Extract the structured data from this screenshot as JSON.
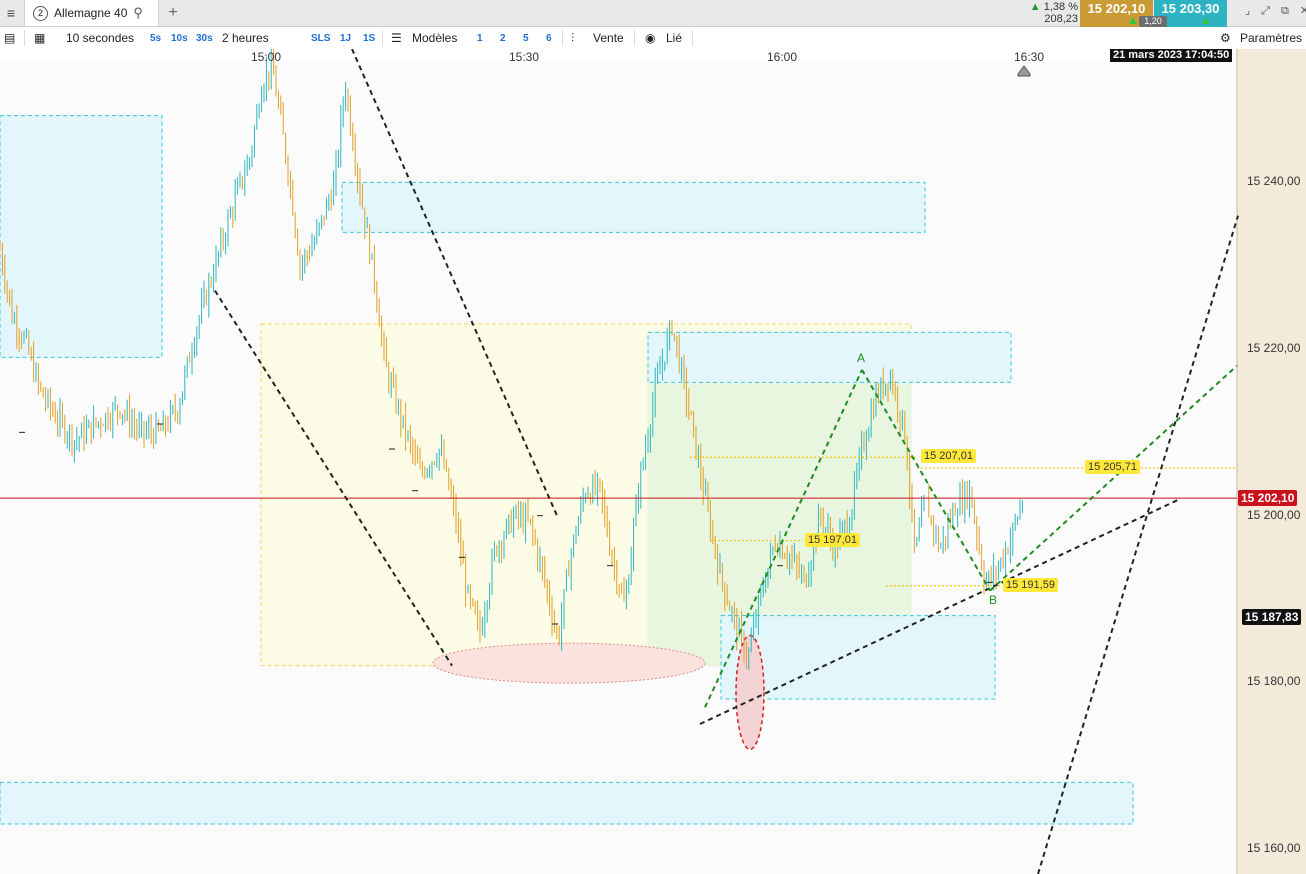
{
  "tabbar": {
    "tab_number": "2",
    "tab_label": "Allemagne 40",
    "change_pct": "1,38 %",
    "change_pts": "208,23",
    "bid": "15 202,10",
    "ask": "15 203,30",
    "spread": "1,20"
  },
  "toolbar": {
    "interval": "10 secondes",
    "quick_intervals": [
      "5s",
      "10s",
      "30s"
    ],
    "period": "2 heures",
    "quick_periods": [
      "SLS",
      "1J",
      "1S"
    ],
    "models_label": "Modèles",
    "model_slots": [
      "1",
      "2",
      "5",
      "6"
    ],
    "price_type": "Vente",
    "link_label": "Lié",
    "settings_label": "Paramètres"
  },
  "colors": {
    "bid_bg": "#c99a36",
    "ask_bg": "#2eb3c3",
    "up_candle": "#2fb7c0",
    "down_candle": "#e0a02a",
    "current_price_line": "#c8111a",
    "trendline_green": "#1e8c1e",
    "trendline_black": "#222222",
    "zone_cyan": "#e3f6fb",
    "zone_yellow": "#fcfbe6"
  },
  "chart_data": {
    "type": "candlestick",
    "instrument": "Allemagne 40",
    "timestamp": "21 mars 2023 17:04:50",
    "x_ticks": [
      "15:00",
      "15:30",
      "16:00",
      "16:30"
    ],
    "y_ticks": [
      "15 240,00",
      "15 220,00",
      "15 200,00",
      "15 180,00",
      "15 160,00"
    ],
    "ylim": [
      15157,
      15256
    ],
    "current_price": 15202.1,
    "current_price_label": "15 202,10",
    "cursor_price_label": "15 187,83",
    "cursor_price": 15187.83,
    "levels": [
      {
        "label": "15 207,01",
        "price": 15207.01
      },
      {
        "label": "15 205,71",
        "price": 15205.71
      },
      {
        "label": "15 197,01",
        "price": 15197.01
      },
      {
        "label": "15 191,59",
        "price": 15191.59
      }
    ],
    "pattern_points": [
      {
        "label": "A",
        "price": 15217.5
      },
      {
        "label": "B",
        "price": 15191.0
      }
    ],
    "ohlc_anchor_path": [
      [
        0,
        15232
      ],
      [
        12,
        15224
      ],
      [
        25,
        15221
      ],
      [
        40,
        15215
      ],
      [
        55,
        15212
      ],
      [
        75,
        15209
      ],
      [
        95,
        15211
      ],
      [
        120,
        15213
      ],
      [
        140,
        15210
      ],
      [
        160,
        15210
      ],
      [
        178,
        15213
      ],
      [
        195,
        15222
      ],
      [
        215,
        15230
      ],
      [
        235,
        15238
      ],
      [
        250,
        15243
      ],
      [
        262,
        15252
      ],
      [
        272,
        15254
      ],
      [
        290,
        15240
      ],
      [
        300,
        15230
      ],
      [
        315,
        15233
      ],
      [
        335,
        15240
      ],
      [
        345,
        15252
      ],
      [
        360,
        15239
      ],
      [
        375,
        15228
      ],
      [
        385,
        15218
      ],
      [
        400,
        15212
      ],
      [
        420,
        15205
      ],
      [
        440,
        15208
      ],
      [
        455,
        15200
      ],
      [
        468,
        15190
      ],
      [
        480,
        15186
      ],
      [
        495,
        15196
      ],
      [
        515,
        15200
      ],
      [
        530,
        15199
      ],
      [
        545,
        15192
      ],
      [
        558,
        15185
      ],
      [
        570,
        15195
      ],
      [
        585,
        15203
      ],
      [
        600,
        15203
      ],
      [
        612,
        15195
      ],
      [
        625,
        15189
      ],
      [
        638,
        15203
      ],
      [
        655,
        15215
      ],
      [
        672,
        15223
      ],
      [
        690,
        15212
      ],
      [
        705,
        15202
      ],
      [
        720,
        15193
      ],
      [
        735,
        15187
      ],
      [
        748,
        15183
      ],
      [
        760,
        15190
      ],
      [
        775,
        15197
      ],
      [
        790,
        15195
      ],
      [
        805,
        15192
      ],
      [
        820,
        15200
      ],
      [
        835,
        15196
      ],
      [
        850,
        15200
      ],
      [
        862,
        15208
      ],
      [
        875,
        15214
      ],
      [
        890,
        15217
      ],
      [
        905,
        15210
      ],
      [
        915,
        15195
      ],
      [
        925,
        15202
      ],
      [
        940,
        15196
      ],
      [
        955,
        15201
      ],
      [
        970,
        15203
      ],
      [
        985,
        15192
      ],
      [
        995,
        15193
      ],
      [
        1010,
        15197
      ],
      [
        1023,
        15202
      ]
    ],
    "zones": [
      {
        "color": "cyan",
        "price_top": 15248,
        "price_bottom": 15219
      },
      {
        "color": "cyan",
        "price_top": 15240,
        "price_bottom": 15234
      },
      {
        "color": "yellow",
        "price_top": 15223,
        "price_bottom": 15182
      },
      {
        "color": "green",
        "price_top": 15222,
        "price_bottom": 15182
      },
      {
        "color": "cyan",
        "price_top": 15222,
        "price_bottom": 15216
      },
      {
        "color": "cyan",
        "price_top": 15188,
        "price_bottom": 15178
      },
      {
        "color": "cyan",
        "price_top": 15168,
        "price_bottom": 15163
      }
    ]
  }
}
